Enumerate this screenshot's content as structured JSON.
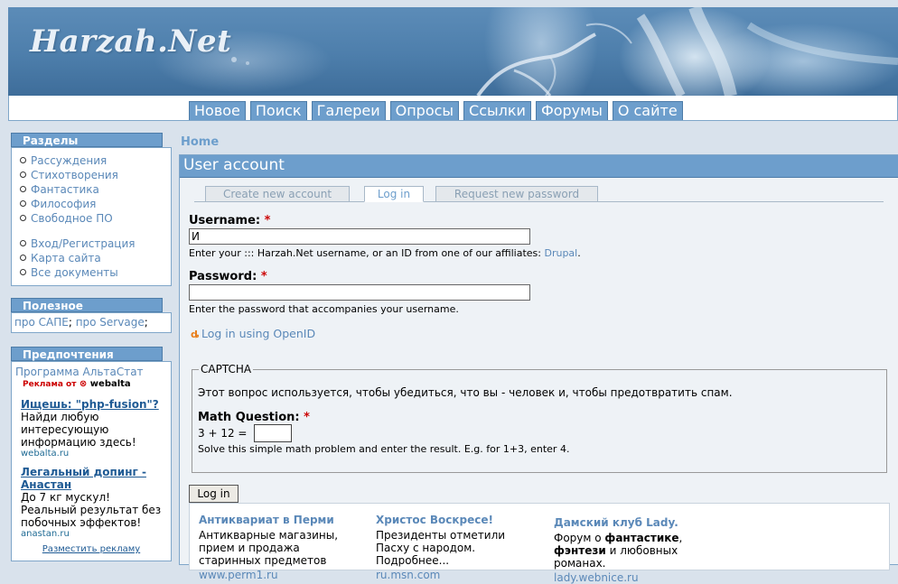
{
  "header": {
    "site_name": "Harzah.Net"
  },
  "nav": {
    "tabs": [
      "Новое",
      "Поиск",
      "Галереи",
      "Опросы",
      "Ссылки",
      "Форумы",
      "О сайте"
    ]
  },
  "sidebar": {
    "sections": {
      "title": "Разделы",
      "items": [
        "Рассуждения",
        "Стихотворения",
        "Фантастика",
        "Философия",
        "Свободное ПО"
      ],
      "items2": [
        "Вход/Регистрация",
        "Карта сайта",
        "Все документы"
      ]
    },
    "useful": {
      "title": "Полезное",
      "link1": "про САПЕ",
      "sep": ";",
      "link2": "про Servage",
      "end": ";"
    },
    "prefs": {
      "title": "Предпочтения",
      "program": "Программа АльтаСтат",
      "ad_label": "Реклама от",
      "ad_brand": "webalta",
      "ads": [
        {
          "title": "Ищешь: \"php-fusion\"?",
          "text": "Найди любую интересующую информацию здесь!",
          "url": "webalta.ru"
        },
        {
          "title": "Легальный допинг - Анастан",
          "text": "До 7 кг мускул! Реальный результат без побочных эффектов!",
          "url": "anastan.ru"
        }
      ],
      "place_ad": "Разместить рекламу"
    }
  },
  "breadcrumb": "Home",
  "main": {
    "title": "User account",
    "tabs": [
      "Create new account",
      "Log in",
      "Request new password"
    ],
    "active_tab": "Log in",
    "username_label": "Username:",
    "username_value": "И",
    "username_desc_pre": "Enter your ::: Harzah.Net username, or an ID from one of our affiliates:",
    "username_desc_link": "Drupal",
    "username_desc_post": ".",
    "password_label": "Password:",
    "password_value": "",
    "password_desc": "Enter the password that accompanies your username.",
    "required_mark": "*",
    "openid_link": "Log in using OpenID",
    "captcha": {
      "legend": "CAPTCHA",
      "info": "Этот вопрос используется, чтобы убедиться, что вы - человек и, чтобы предотвратить спам.",
      "math_label": "Math Question:",
      "question": "3 + 12 =",
      "desc": "Solve this simple math problem and enter the result. E.g. for 1+3, enter 4."
    },
    "login_button": "Log in"
  },
  "ads_bottom": [
    {
      "title": "Антиквариат в Перми",
      "body": "Антикварные магазины, прием и продажа старинных предметов",
      "url": "www.perm1.ru"
    },
    {
      "title": "Христос Воскресе!",
      "body": "Президенты отметили Пасху с народом. Подробнее...",
      "url": "ru.msn.com"
    },
    {
      "title": "Дамский клуб Lady.",
      "body_pre": "Форум о ",
      "b1": "фантастике",
      "mid1": ", ",
      "b2": "фэнтези",
      "body_post": " и любовных романах.",
      "url": "lady.webnice.ru"
    }
  ],
  "colors": {
    "accent": "#6d9ecc",
    "link": "#5a88b8",
    "background": "#d9e2ec",
    "required": "#cc0000"
  }
}
